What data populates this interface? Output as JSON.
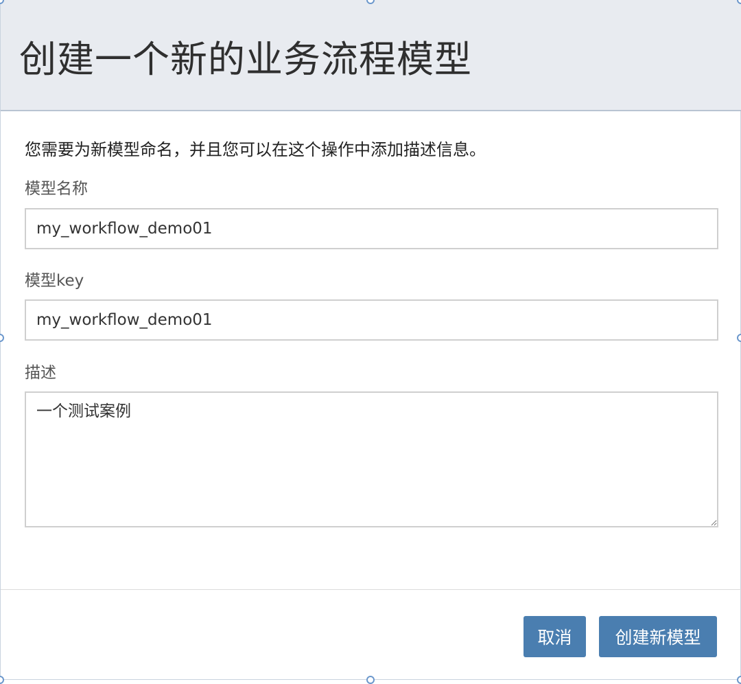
{
  "dialog": {
    "title": "创建一个新的业务流程模型",
    "description": "您需要为新模型命名，并且您可以在这个操作中添加描述信息。",
    "fields": {
      "name": {
        "label": "模型名称",
        "value": "my_workflow_demo01"
      },
      "key": {
        "label": "模型key",
        "value": "my_workflow_demo01"
      },
      "description": {
        "label": "描述",
        "value": "一个测试案例"
      }
    },
    "buttons": {
      "cancel": "取消",
      "create": "创建新模型"
    }
  },
  "colors": {
    "header_bg": "#e8ebf0",
    "button_bg": "#4a7eb0",
    "handle": "#6b97cc"
  }
}
